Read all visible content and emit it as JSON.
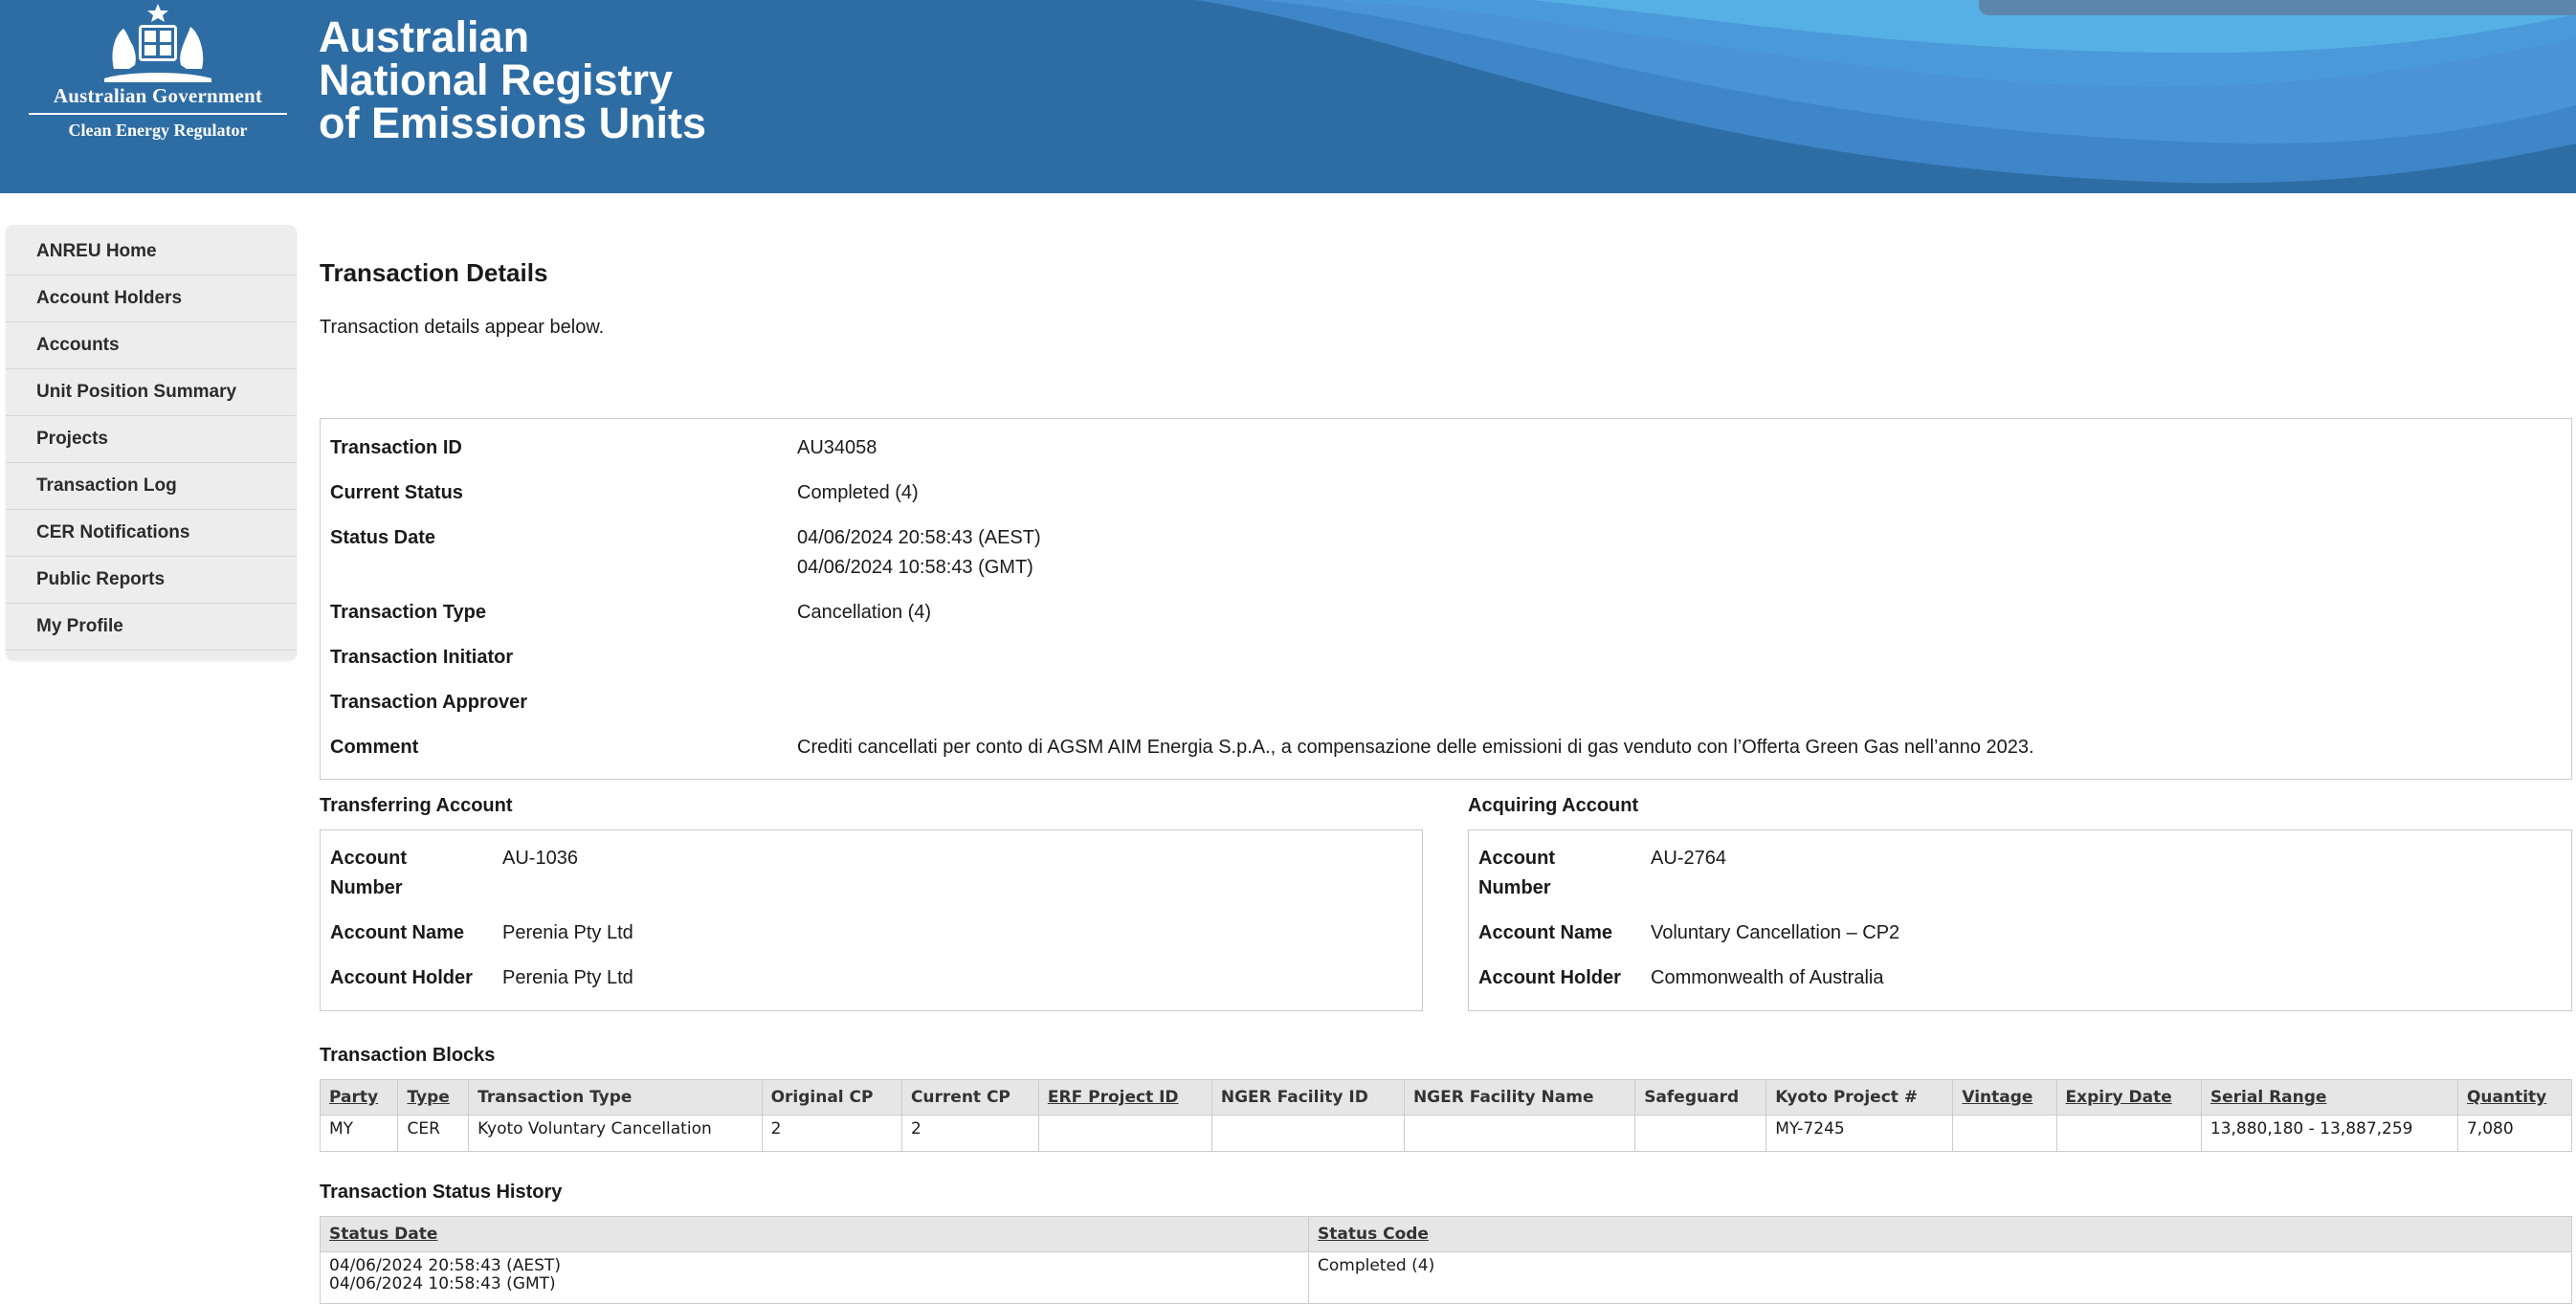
{
  "header": {
    "government": "Australian Government",
    "regulator": "Clean Energy Regulator",
    "title_lines": [
      "Australian",
      "National Registry",
      "of Emissions Units"
    ]
  },
  "sidebar": {
    "items": [
      {
        "label": "ANREU Home"
      },
      {
        "label": "Account Holders"
      },
      {
        "label": "Accounts"
      },
      {
        "label": "Unit Position Summary"
      },
      {
        "label": "Projects"
      },
      {
        "label": "Transaction Log"
      },
      {
        "label": "CER Notifications"
      },
      {
        "label": "Public Reports"
      },
      {
        "label": "My Profile"
      }
    ]
  },
  "page": {
    "title": "Transaction Details",
    "intro": "Transaction details appear below."
  },
  "details": {
    "transaction_id": {
      "label": "Transaction ID",
      "value": "AU34058"
    },
    "current_status": {
      "label": "Current Status",
      "value": "Completed (4)"
    },
    "status_date": {
      "label": "Status Date",
      "value_line1": "04/06/2024 20:58:43 (AEST)",
      "value_line2": "04/06/2024 10:58:43 (GMT)"
    },
    "transaction_type": {
      "label": "Transaction Type",
      "value": "Cancellation (4)"
    },
    "initiator": {
      "label": "Transaction Initiator",
      "value": ""
    },
    "approver": {
      "label": "Transaction Approver",
      "value": ""
    },
    "comment": {
      "label": "Comment",
      "value": "Crediti cancellati per conto di AGSM AIM Energia S.p.A., a compensazione delle emissioni di gas venduto con l’Offerta Green Gas nell’anno 2023."
    }
  },
  "transferring": {
    "heading": "Transferring Account",
    "number_label_1": "Account",
    "number_label_2": "Number",
    "number": "AU-1036",
    "name_label": "Account Name",
    "name": "Perenia Pty Ltd",
    "holder_label": "Account Holder",
    "holder": "Perenia Pty Ltd"
  },
  "acquiring": {
    "heading": "Acquiring Account",
    "number_label_1": "Account",
    "number_label_2": "Number",
    "number": "AU-2764",
    "name_label": "Account Name",
    "name": "Voluntary Cancellation – CP2",
    "holder_label": "Account Holder",
    "holder": "Commonwealth of Australia"
  },
  "blocks": {
    "heading": "Transaction Blocks",
    "columns": [
      "Party",
      "Type",
      "Transaction Type",
      "Original CP",
      "Current CP",
      "ERF Project ID",
      "NGER Facility ID",
      "NGER Facility Name",
      "Safeguard",
      "Kyoto Project #",
      "Vintage",
      "Expiry Date",
      "Serial Range",
      "Quantity"
    ],
    "rows": [
      [
        "MY",
        "CER",
        "Kyoto Voluntary Cancellation",
        "2",
        "2",
        "",
        "",
        "",
        "",
        "MY-7245",
        "",
        "",
        "13,880,180 - 13,887,259",
        "7,080"
      ]
    ]
  },
  "history": {
    "heading": "Transaction Status History",
    "columns": [
      "Status Date",
      "Status Code"
    ],
    "rows": [
      {
        "date_line1": "04/06/2024 20:58:43 (AEST)",
        "date_line2": "04/06/2024 10:58:43 (GMT)",
        "code": "Completed (4)"
      }
    ]
  },
  "colors": {
    "header_blue": "#2e6da4",
    "wave_light": "#56b0e5",
    "wave_mid": "#4a93d4",
    "sidebar_bg": "#ededed",
    "table_header_bg": "#e6e6e6"
  }
}
